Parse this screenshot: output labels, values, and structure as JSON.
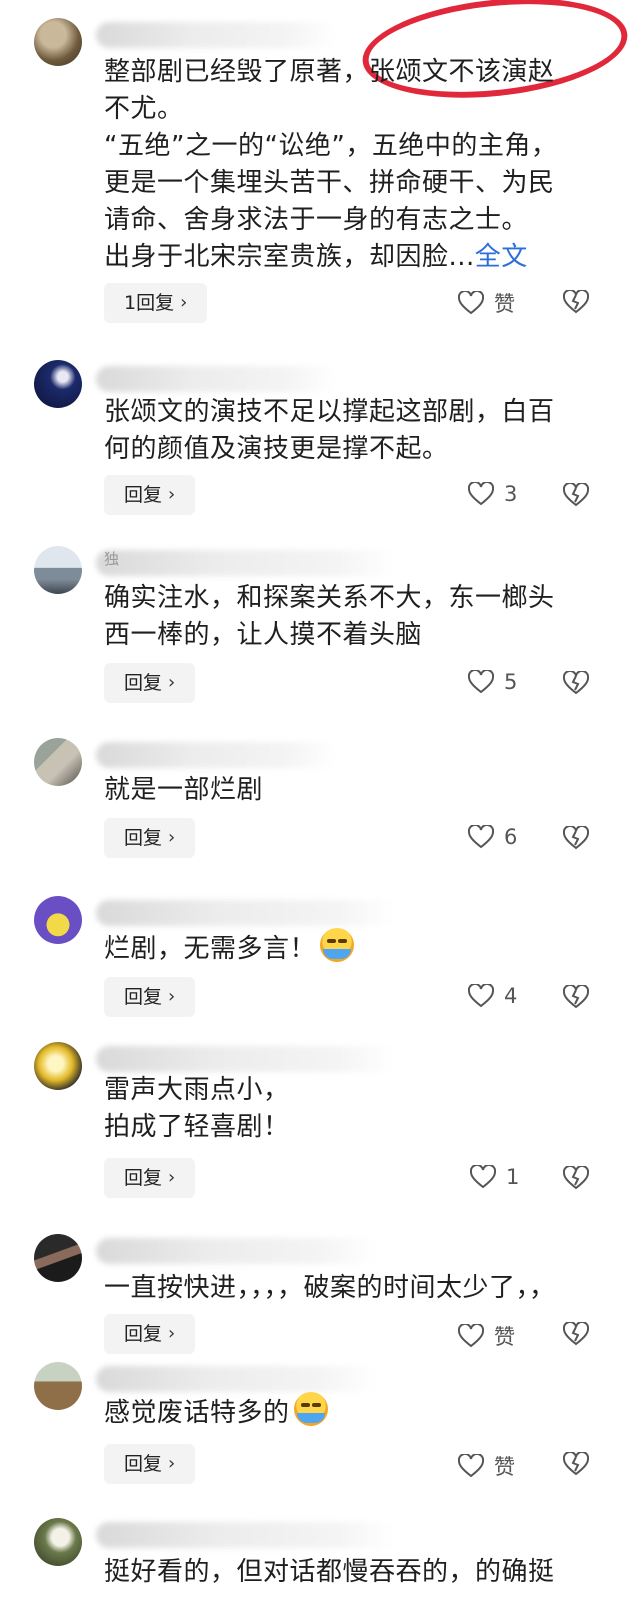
{
  "comments": [
    {
      "lines": [
        "整部剧已经毁了原著，张颂文不该演赵",
        "不尤。",
        "“五绝”之一的“讼绝”，五绝中的主角，",
        "更是一个集埋头苦干、拼命硬干、为民",
        "请命、舍身求法于一身的有志之士。",
        "出身于北宋宗室贵族，却因脸..."
      ],
      "more_link": "全文",
      "reply_label": "1回复",
      "like_label": "赞"
    },
    {
      "lines": [
        "张颂文的演技不足以撑起这部剧，白百",
        "何的颜值及演技更是撑不起。"
      ],
      "reply_label": "回复",
      "like_label": "3"
    },
    {
      "name_partial": "独",
      "lines": [
        "确实注水，和探案关系不大，东一榔头",
        "西一棒的，让人摸不着头脑"
      ],
      "reply_label": "回复",
      "like_label": "5"
    },
    {
      "lines": [
        "就是一部烂剧"
      ],
      "reply_label": "回复",
      "like_label": "6"
    },
    {
      "lines": [
        "烂剧，无需多言！"
      ],
      "reply_label": "回复",
      "like_label": "4"
    },
    {
      "lines": [
        "雷声大雨点小，",
        "拍成了轻喜剧！"
      ],
      "reply_label": "回复",
      "like_label": "1"
    },
    {
      "lines": [
        "一直按快进，，，，破案的时间太少了，，"
      ],
      "reply_label": "回复",
      "like_label": "赞"
    },
    {
      "lines": [
        "感觉废话特多的"
      ],
      "reply_label": "回复",
      "like_label": "赞"
    },
    {
      "lines": [
        "挺好看的，但对话都慢吞吞的，的确挺"
      ],
      "reply_label": "",
      "like_label": ""
    }
  ],
  "reply_chevron": "›",
  "icons": {
    "like": "heart-outline-icon",
    "dislike": "broken-heart-icon",
    "highlight": "red-circle-annotation"
  },
  "colors": {
    "link": "#2d6fd8",
    "annotation": "#e0283a"
  }
}
